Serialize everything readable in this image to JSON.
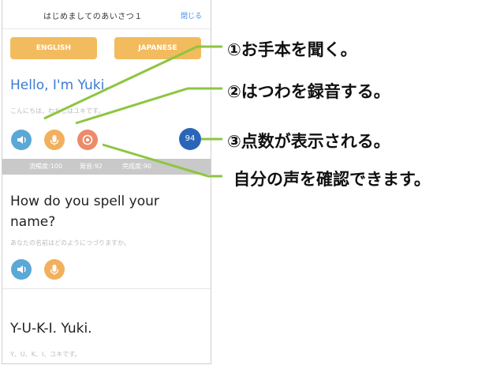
{
  "header": {
    "title": "はじめましてのあいさつ１",
    "close_label": "閉じる"
  },
  "language_buttons": {
    "english": "ENGLISH",
    "japanese": "JAPANESE"
  },
  "lessons": [
    {
      "phrase": "Hello, I'm Yuki.",
      "translation": "こんにちは、わたしはユキです。"
    },
    {
      "phrase": "How do you spell your name?",
      "translation": "あなたの名前はどのようにつづりますか。"
    },
    {
      "phrase": "Y-U-K-I. Yuki.",
      "translation": "Y、U、K、I、ユキです。"
    }
  ],
  "score": {
    "value": "94"
  },
  "score_bar": {
    "fluency": "流暢度:100",
    "pronunciation": "発音:92",
    "completeness": "完成度:90"
  },
  "annotations": {
    "listen": "①お手本を聞く。",
    "record": "②はつわを録音する。",
    "score": "③点数が表示される。",
    "playback": "自分の声を確認できます。"
  },
  "colors": {
    "accent_blue": "#3b7bd4",
    "lang_button": "#f2bb5e",
    "speaker": "#5aa8d6",
    "mic": "#f2b05e",
    "playback": "#ec8b6a",
    "score": "#2a66b8",
    "callout_line": "#8cc63f"
  },
  "icons": {
    "speaker": "speaker-icon",
    "mic": "microphone-icon",
    "playback": "playback-icon"
  }
}
